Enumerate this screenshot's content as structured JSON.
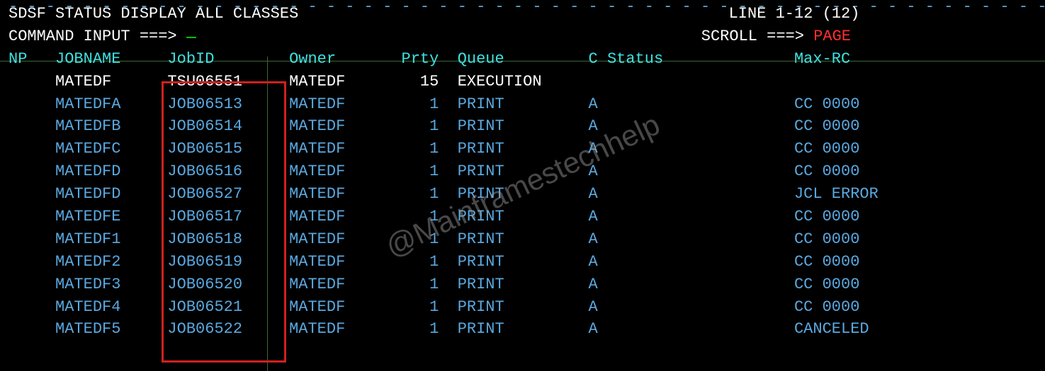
{
  "title": "SDSF STATUS DISPLAY ALL CLASSES",
  "line_info": "LINE 1-12 (12)",
  "command_label": "COMMAND INPUT ===>",
  "command_value": "",
  "scroll_label": "SCROLL ===>",
  "scroll_value": "PAGE",
  "headers": {
    "np": "NP",
    "jobname": "JOBNAME",
    "jobid": "JobID",
    "owner": "Owner",
    "prty": "Prty",
    "queue": "Queue",
    "c": "C",
    "status": "Status",
    "maxrc": "Max-RC"
  },
  "rows": [
    {
      "jobname": "MATEDF",
      "jobid": "TSU06551",
      "owner": "MATEDF",
      "prty": "15",
      "queue": "EXECUTION",
      "c": "",
      "maxrc": "",
      "hl": true
    },
    {
      "jobname": "MATEDFA",
      "jobid": "JOB06513",
      "owner": "MATEDF",
      "prty": "1",
      "queue": "PRINT",
      "c": "A",
      "maxrc": "CC 0000",
      "hl": false
    },
    {
      "jobname": "MATEDFB",
      "jobid": "JOB06514",
      "owner": "MATEDF",
      "prty": "1",
      "queue": "PRINT",
      "c": "A",
      "maxrc": "CC 0000",
      "hl": false
    },
    {
      "jobname": "MATEDFC",
      "jobid": "JOB06515",
      "owner": "MATEDF",
      "prty": "1",
      "queue": "PRINT",
      "c": "A",
      "maxrc": "CC 0000",
      "hl": false
    },
    {
      "jobname": "MATEDFD",
      "jobid": "JOB06516",
      "owner": "MATEDF",
      "prty": "1",
      "queue": "PRINT",
      "c": "A",
      "maxrc": "CC 0000",
      "hl": false
    },
    {
      "jobname": "MATEDFD",
      "jobid": "JOB06527",
      "owner": "MATEDF",
      "prty": "1",
      "queue": "PRINT",
      "c": "A",
      "maxrc": "JCL ERROR",
      "hl": false
    },
    {
      "jobname": "MATEDFE",
      "jobid": "JOB06517",
      "owner": "MATEDF",
      "prty": "1",
      "queue": "PRINT",
      "c": "A",
      "maxrc": "CC 0000",
      "hl": false
    },
    {
      "jobname": "MATEDF1",
      "jobid": "JOB06518",
      "owner": "MATEDF",
      "prty": "1",
      "queue": "PRINT",
      "c": "A",
      "maxrc": "CC 0000",
      "hl": false
    },
    {
      "jobname": "MATEDF2",
      "jobid": "JOB06519",
      "owner": "MATEDF",
      "prty": "1",
      "queue": "PRINT",
      "c": "A",
      "maxrc": "CC 0000",
      "hl": false
    },
    {
      "jobname": "MATEDF3",
      "jobid": "JOB06520",
      "owner": "MATEDF",
      "prty": "1",
      "queue": "PRINT",
      "c": "A",
      "maxrc": "CC 0000",
      "hl": false
    },
    {
      "jobname": "MATEDF4",
      "jobid": "JOB06521",
      "owner": "MATEDF",
      "prty": "1",
      "queue": "PRINT",
      "c": "A",
      "maxrc": "CC 0000",
      "hl": false
    },
    {
      "jobname": "MATEDF5",
      "jobid": "JOB06522",
      "owner": "MATEDF",
      "prty": "1",
      "queue": "PRINT",
      "c": "A",
      "maxrc": "CANCELED",
      "hl": false
    }
  ],
  "watermark": "@Mainframestechhelp",
  "layout": {
    "col_jobname": 5,
    "col_jobid": 17,
    "col_owner": 30,
    "col_prty_end": 46,
    "col_queue": 48,
    "col_c": 63,
    "col_status": 65,
    "col_maxrc": 85,
    "line_info_pad": 77
  }
}
